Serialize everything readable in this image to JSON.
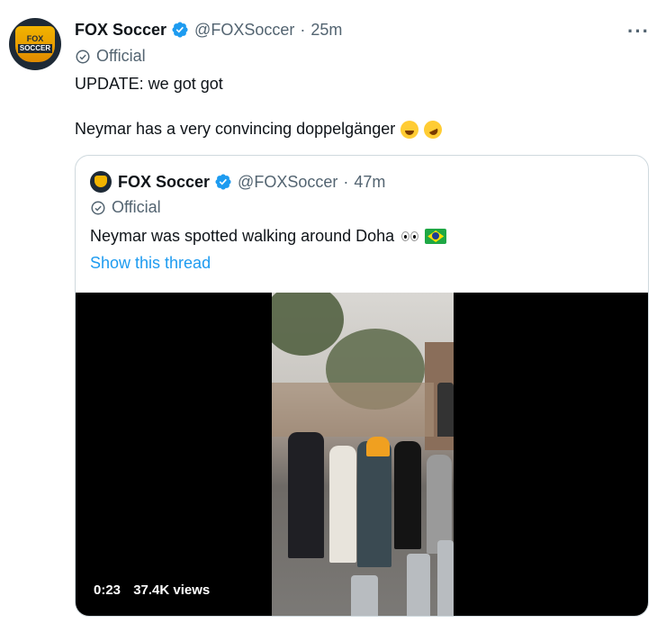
{
  "tweet": {
    "author_name": "FOX Soccer",
    "handle": "@FOXSoccer",
    "separator": "·",
    "time": "25m",
    "badge": "Official",
    "more": "···",
    "avatar_text_top": "FOX",
    "avatar_text_bottom": "SOCCER",
    "text_line1": "UPDATE: we got got",
    "text_line2": "Neymar has a very convincing doppelgänger",
    "emojis": [
      "grinning-sweat-emoji",
      "rofl-emoji"
    ]
  },
  "quoted": {
    "author_name": "FOX Soccer",
    "handle": "@FOXSoccer",
    "separator": "·",
    "time": "47m",
    "badge": "Official",
    "text": "Neymar was spotted walking around Doha",
    "emojis": [
      "eyes-emoji",
      "brazil-flag-emoji"
    ],
    "show_thread": "Show this thread",
    "video": {
      "duration": "0:23",
      "views": "37.4K views"
    }
  },
  "colors": {
    "text": "#0f1419",
    "secondary": "#536471",
    "link": "#1d9bf0",
    "verified": "#1d9bf0",
    "border": "#cfd9de"
  }
}
